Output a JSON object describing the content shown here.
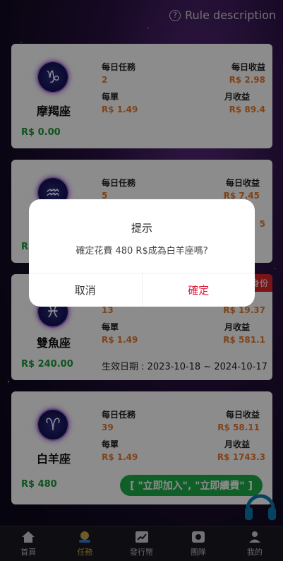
{
  "header": {
    "rule_label": "Rule description"
  },
  "labels": {
    "daily_tasks": "每日任務",
    "daily_income": "每日收益",
    "per_order": "每單",
    "monthly_income": "月收益"
  },
  "cards": [
    {
      "name": "摩羯座",
      "symbol": "♑",
      "daily_tasks": "2",
      "daily_income": "R$ 2.98",
      "per_order": "R$ 1.49",
      "monthly_income": "R$ 89.4",
      "price": "R$ 0.00"
    },
    {
      "name": "",
      "symbol": "♒",
      "daily_tasks": "5",
      "daily_income": "R$ 7.45",
      "monthly_income_partial": "5",
      "price_partial": "R"
    },
    {
      "name": "雙魚座",
      "symbol": "♓",
      "daily_tasks": "13",
      "daily_income": "R$ 19.37",
      "per_order": "R$ 1.49",
      "monthly_income": "R$ 581.1",
      "price": "R$ 240.00",
      "validity": "生效日期 : 2023-10-18 ~ 2024-10-17",
      "ribbon": "身份"
    },
    {
      "name": "白羊座",
      "symbol": "♈",
      "daily_tasks": "39",
      "daily_income": "R$ 58.11",
      "per_order": "R$ 1.49",
      "monthly_income": "R$ 1743.3",
      "price": "R$ 480",
      "join_label": "[ \"立即加入\", \"立即續費\" ]"
    }
  ],
  "dialog": {
    "title": "提示",
    "message": "確定花費 480 R$成為白羊座嗎?",
    "cancel_label": "取消",
    "confirm_label": "確定"
  },
  "tabs": [
    {
      "label": "首頁",
      "icon": "home-icon",
      "active": false
    },
    {
      "label": "任務",
      "icon": "task-icon",
      "active": true
    },
    {
      "label": "發行幣",
      "icon": "chart-icon",
      "active": false
    },
    {
      "label": "團隊",
      "icon": "team-icon",
      "active": false
    },
    {
      "label": "我的",
      "icon": "user-icon",
      "active": false
    }
  ],
  "colors": {
    "accent": "#e0213b",
    "price": "#1d9a3a",
    "value": "#e87a2a",
    "join": "#1fae4a"
  }
}
